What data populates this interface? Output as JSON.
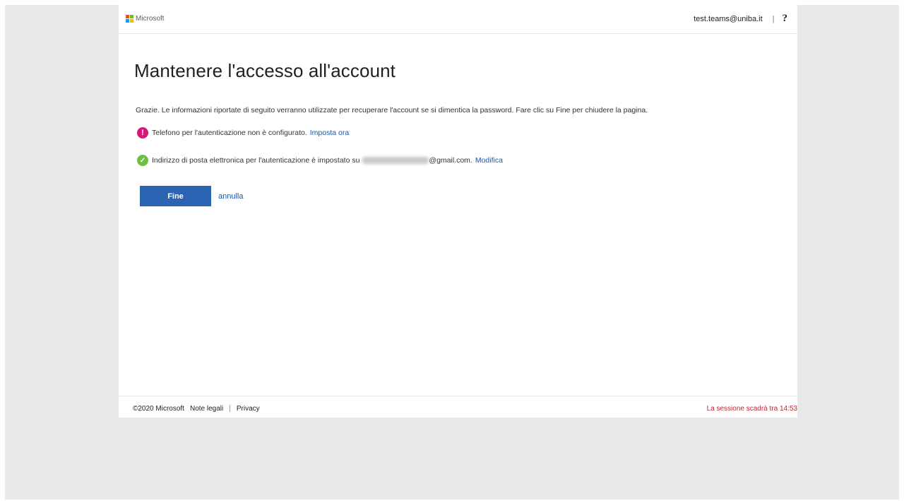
{
  "header": {
    "logo_text": "Microsoft",
    "logo_colors": [
      "#f25022",
      "#7fba00",
      "#00a4ef",
      "#ffb900"
    ],
    "user_email": "test.teams@uniba.it",
    "separator": "|",
    "help_label": "?"
  },
  "main": {
    "title": "Mantenere l'accesso all'account",
    "intro": "Grazie. Le informazioni riportate di seguito verranno utilizzate per recuperare l'account se si dimentica la password. Fare clic su Fine per chiudere la pagina.",
    "items": [
      {
        "icon": "error-icon",
        "icon_glyph": "!",
        "text": "Telefono per l'autenticazione non è configurato.",
        "link": "Imposta ora"
      },
      {
        "icon": "check-icon",
        "icon_glyph": "✓",
        "text": "Indirizzo di posta elettronica per l'autenticazione è impostato su",
        "email_suffix": "@gmail.com.",
        "link": "Modifica"
      }
    ],
    "done_button": "Fine",
    "cancel_link": "annulla"
  },
  "footer": {
    "copyright": "©2020 Microsoft",
    "legal_link": "Note legali",
    "separator": "|",
    "privacy_link": "Privacy",
    "session_text": "La sessione scadrà tra 14:53"
  },
  "colors": {
    "accent": "#2b64b3",
    "link": "#1a57a8",
    "error": "#d9167a",
    "success": "#6cbf44",
    "warning_text": "#c4262e"
  }
}
